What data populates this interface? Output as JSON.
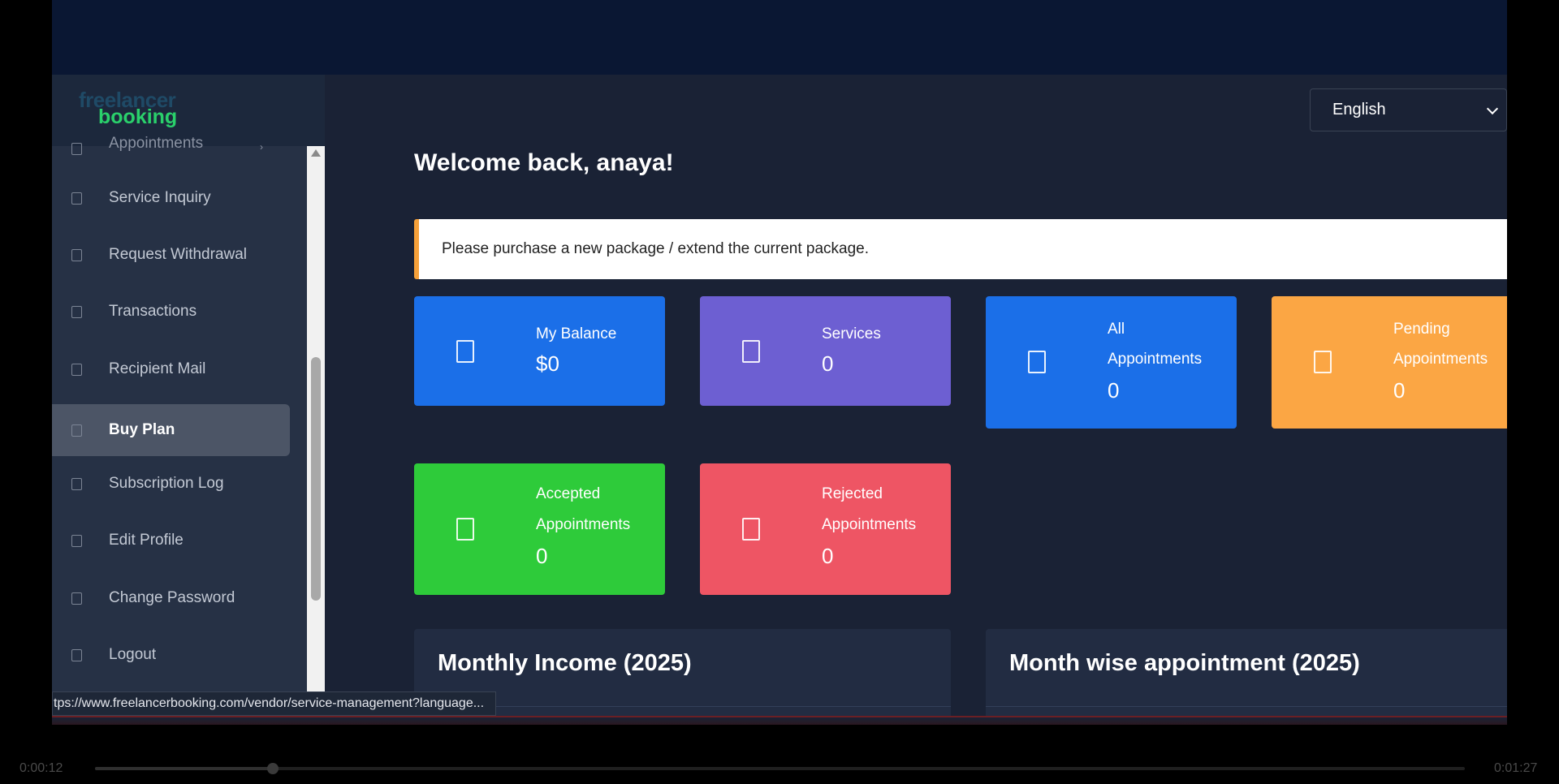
{
  "brand": {
    "line1": "freelancer",
    "line2": "booking"
  },
  "sidebar": {
    "items": [
      {
        "label": "Appointments"
      },
      {
        "label": "Service Inquiry"
      },
      {
        "label": "Request Withdrawal"
      },
      {
        "label": "Transactions"
      },
      {
        "label": "Recipient Mail"
      },
      {
        "label": "Buy Plan",
        "active": true
      },
      {
        "label": "Subscription Log"
      },
      {
        "label": "Edit Profile"
      },
      {
        "label": "Change Password"
      },
      {
        "label": "Logout"
      }
    ]
  },
  "header": {
    "language": "English"
  },
  "welcome": "Welcome back, anaya!",
  "alert": "Please purchase a new package / extend the current package.",
  "cards": [
    {
      "line1": "My Balance",
      "line2": "",
      "value": "$0",
      "color": "#1b6fe8"
    },
    {
      "line1": "Services",
      "line2": "",
      "value": "0",
      "color": "#6d5fd2"
    },
    {
      "line1": "All",
      "line2": "Appointments",
      "value": "0",
      "color": "#1b6fe8"
    },
    {
      "line1": "Pending",
      "line2": "Appointments",
      "value": "0",
      "color": "#fba644"
    },
    {
      "line1": "Accepted",
      "line2": "Appointments",
      "value": "0",
      "color": "#2ecb3a"
    },
    {
      "line1": "Rejected",
      "line2": "Appointments",
      "value": "0",
      "color": "#ee5564"
    }
  ],
  "panels": {
    "income_title": "Monthly Income (2025)",
    "appointment_title": "Month wise appointment (2025)"
  },
  "status_url": "tps://www.freelancerbooking.com/vendor/service-management?language...",
  "video": {
    "elapsed": "0:00:12",
    "duration": "0:01:27",
    "progress": 0.13
  }
}
